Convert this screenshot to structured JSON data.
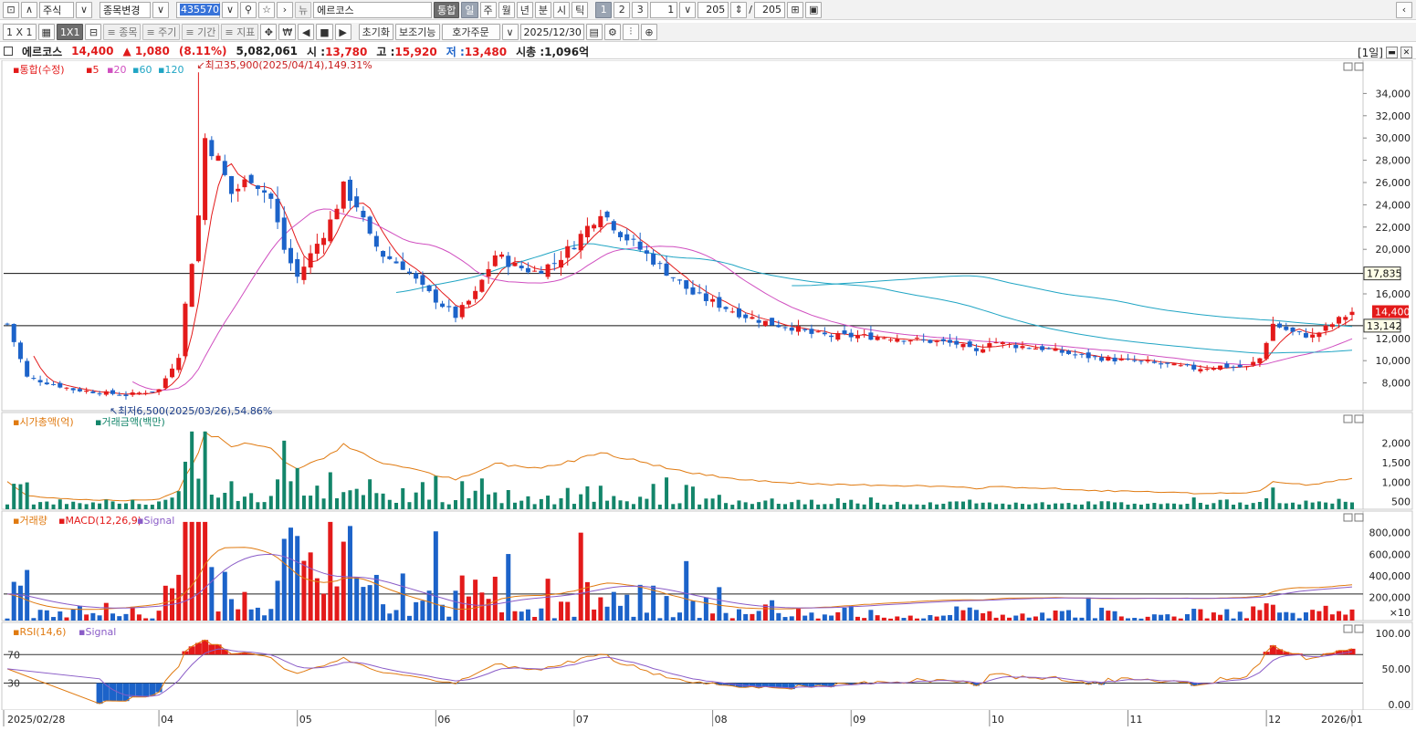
{
  "toolbar1": {
    "market": "주식",
    "change_label": "종목변경",
    "code": "435570",
    "stock_name": "에르코스",
    "integrated": "통합",
    "periods": [
      "일",
      "주",
      "월",
      "년",
      "분",
      "시",
      "틱"
    ],
    "pages": [
      "1",
      "2",
      "3"
    ],
    "count_value": "1",
    "bars_value": "205",
    "slash": "/",
    "bars_total": "205"
  },
  "toolbar2": {
    "layouts": [
      "1 X 1",
      "1X1"
    ],
    "item_btn": "≡ 종목",
    "period_btn": "≡ 주기",
    "range_btn": "≡ 기간",
    "indicator_btn": "≡ 지표",
    "won_icon": "₩",
    "reset": "초기화",
    "aux": "보조기능",
    "order": "호가주문",
    "date": "2025/12/30"
  },
  "info": {
    "name": "에르코스",
    "price": "14,400",
    "change": "▲ 1,080",
    "pct": "(8.11%)",
    "volume": "5,082,061",
    "open_label": "시 :",
    "open": "13,780",
    "high_label": "고 :",
    "high": "15,920",
    "low_label": "저 :",
    "low": "13,480",
    "mcap_label": "시총 :",
    "mcap": "1,096억",
    "period_tag": "[1일]"
  },
  "legends": {
    "price": [
      "통합(수정)",
      "5",
      "20",
      "60",
      "120"
    ],
    "mcap": [
      "시가총액(억)",
      "거래금액(백만)"
    ],
    "macd": [
      "거래량",
      "MACD(12,26,9)",
      "Signal"
    ],
    "rsi": [
      "RSI(14,6)",
      "Signal"
    ]
  },
  "colors": {
    "up": "#e31a1a",
    "down": "#1c63c9",
    "ma5": "#e31a1a",
    "ma20": "#d04fc0",
    "ma60": "#20a5c4",
    "ma120": "#20a5c4",
    "mcap": "#e07a10",
    "amount": "#13856a"
  },
  "chart_data": {
    "type": "candlestick",
    "x_ticks": [
      "2025/02/28",
      "04",
      "05",
      "06",
      "07",
      "08",
      "09",
      "10",
      "11",
      "12",
      "2026/01"
    ],
    "price_axis": [
      "34,000",
      "32,000",
      "30,000",
      "28,000",
      "26,000",
      "24,000",
      "22,000",
      "20,000",
      "16,000",
      "12,000",
      "10,000",
      "8,000"
    ],
    "ylim": [
      6000,
      36000
    ],
    "hline_values": [
      17835,
      13142
    ],
    "hline_labels": [
      "17,835",
      "13,142"
    ],
    "last_label": "14,400",
    "high_note": "최고35,900(2025/04/14),149.31%",
    "high_value": 35900,
    "low_note": "최저6,500(2025/03/26),54.86%",
    "low_value": 6500,
    "mcap_axis": [
      "2,000",
      "1,500",
      "1,000",
      "500"
    ],
    "macd_axis": [
      "800,000",
      "600,000",
      "400,000",
      "200,000",
      "×10"
    ],
    "rsi_axis": [
      "100.00",
      "50.00",
      "0.00"
    ],
    "rsi_levels": [
      "70",
      "30"
    ],
    "rsi_level_values": [
      70,
      30
    ],
    "series": [
      {
        "name": "5",
        "values": []
      },
      {
        "name": "20",
        "values": []
      },
      {
        "name": "60",
        "values": []
      },
      {
        "name": "120",
        "values": []
      }
    ]
  }
}
